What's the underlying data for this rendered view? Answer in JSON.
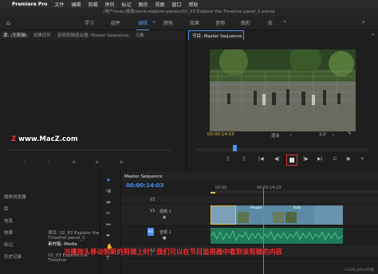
{
  "menubar": {
    "app": "Premiere Pro",
    "items": [
      "文件",
      "编辑",
      "剪辑",
      "序列",
      "标记",
      "图形",
      "视图",
      "窗口",
      "帮助"
    ]
  },
  "path": "/用户/mac/桌面/work-explore-panels/02_03 Explore the Timeline panel_1.prproj",
  "workspaces": {
    "items": [
      "学习",
      "组件",
      "编辑",
      "颜色",
      "效果",
      "音频",
      "图形",
      "库"
    ],
    "active": "编辑"
  },
  "source_panel": {
    "tabs": [
      "源: (无剪辑)",
      "效果控件",
      "音频剪辑混合器: Master Sequence",
      "元数"
    ]
  },
  "program_panel": {
    "tab": "节目: Master Sequence",
    "timecode": "00:00:14:03",
    "fit": "适合",
    "quality": "1/2"
  },
  "watermark": "www.MacZ.com",
  "project_panel": {
    "items": [
      "媒体浏览器",
      "库",
      "信息",
      "效果",
      "标记",
      "历史记录",
      "项目: 02_03 Explore the Timeline panel_1",
      "素材箱: Media",
      "02_03 Explore the Timeline"
    ]
  },
  "timeline": {
    "tab": "Master Sequence",
    "timecode": "00:00:14:03",
    "ruler": [
      "00:00",
      "00:00:14:23"
    ],
    "tracks": {
      "v2": "V2",
      "v1": "V1",
      "v1_name": "视频 1",
      "a1": "A1",
      "a1_name": "音频 1",
      "a2": "A2"
    },
    "clips": [
      "People",
      "Kids"
    ]
  },
  "caption": "当播放头移动到新的剪辑上时，我们可以在节目监视器中看到该剪辑的内容",
  "credit": "CSDN @Mac柠檬"
}
